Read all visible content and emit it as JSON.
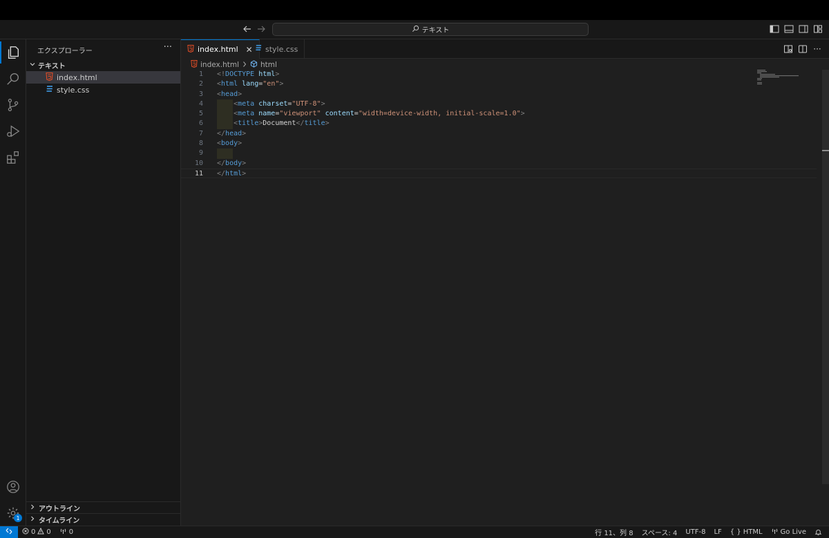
{
  "titlebar": {
    "search_text": "テキスト",
    "back_icon": "arrow-left-icon",
    "forward_icon": "arrow-right-icon"
  },
  "activitybar": {
    "items": [
      "explorer-icon",
      "search-icon",
      "source-control-icon",
      "run-debug-icon",
      "extensions-icon"
    ],
    "bottom": [
      "account-icon",
      "manage-gear-icon"
    ],
    "gear_badge": "1"
  },
  "sidebar": {
    "title": "エクスプローラー",
    "more": "···",
    "folder": "テキスト",
    "files": [
      {
        "name": "index.html",
        "icon": "html-file-icon",
        "selected": true
      },
      {
        "name": "style.css",
        "icon": "css-file-icon",
        "selected": false
      }
    ],
    "outline": "アウトライン",
    "timeline": "タイムライン"
  },
  "tabs": [
    {
      "label": "index.html",
      "active": true
    },
    {
      "label": "style.css",
      "active": false
    }
  ],
  "breadcrumb": {
    "file": "index.html",
    "symbol": "html"
  },
  "editor": {
    "current_line": 11,
    "lines": [
      {
        "n": "1",
        "tokens": [
          [
            "p",
            "<!"
          ],
          [
            "t",
            "DOCTYPE"
          ],
          [
            "x",
            " "
          ],
          [
            "a",
            "html"
          ],
          [
            "p",
            ">"
          ]
        ]
      },
      {
        "n": "2",
        "tokens": [
          [
            "p",
            "<"
          ],
          [
            "t",
            "html"
          ],
          [
            "x",
            " "
          ],
          [
            "a",
            "lang"
          ],
          [
            "x",
            "="
          ],
          [
            "s",
            "\"en\""
          ],
          [
            "p",
            ">"
          ]
        ]
      },
      {
        "n": "3",
        "tokens": [
          [
            "p",
            "<"
          ],
          [
            "t",
            "head"
          ],
          [
            "p",
            ">"
          ]
        ]
      },
      {
        "n": "4",
        "indent": true,
        "tokens": [
          [
            "x",
            "    "
          ],
          [
            "p",
            "<"
          ],
          [
            "t",
            "meta"
          ],
          [
            "x",
            " "
          ],
          [
            "a",
            "charset"
          ],
          [
            "x",
            "="
          ],
          [
            "s",
            "\"UTF-8\""
          ],
          [
            "p",
            ">"
          ]
        ]
      },
      {
        "n": "5",
        "indent": true,
        "tokens": [
          [
            "x",
            "    "
          ],
          [
            "p",
            "<"
          ],
          [
            "t",
            "meta"
          ],
          [
            "x",
            " "
          ],
          [
            "a",
            "name"
          ],
          [
            "x",
            "="
          ],
          [
            "s",
            "\"viewport\""
          ],
          [
            "x",
            " "
          ],
          [
            "a",
            "content"
          ],
          [
            "x",
            "="
          ],
          [
            "s",
            "\"width=device-width, initial-scale=1.0\""
          ],
          [
            "p",
            ">"
          ]
        ]
      },
      {
        "n": "6",
        "indent": true,
        "tokens": [
          [
            "x",
            "    "
          ],
          [
            "p",
            "<"
          ],
          [
            "t",
            "title"
          ],
          [
            "p",
            ">"
          ],
          [
            "x",
            "Document"
          ],
          [
            "p",
            "</"
          ],
          [
            "t",
            "title"
          ],
          [
            "p",
            ">"
          ]
        ]
      },
      {
        "n": "7",
        "tokens": [
          [
            "p",
            "</"
          ],
          [
            "t",
            "head"
          ],
          [
            "p",
            ">"
          ]
        ]
      },
      {
        "n": "8",
        "tokens": [
          [
            "p",
            "<"
          ],
          [
            "t",
            "body"
          ],
          [
            "p",
            ">"
          ]
        ]
      },
      {
        "n": "9",
        "indent": true,
        "tokens": []
      },
      {
        "n": "10",
        "tokens": [
          [
            "p",
            "</"
          ],
          [
            "t",
            "body"
          ],
          [
            "p",
            ">"
          ]
        ]
      },
      {
        "n": "11",
        "tokens": [
          [
            "p",
            "</"
          ],
          [
            "t",
            "html"
          ],
          [
            "p",
            ">"
          ]
        ]
      }
    ]
  },
  "statusbar": {
    "errors": "0",
    "warnings": "0",
    "ports": "0",
    "position": "行 11、列 8",
    "spaces": "スペース: 4",
    "encoding": "UTF-8",
    "eol": "LF",
    "language": "HTML",
    "golive": "Go Live"
  },
  "colors": {
    "accent": "#0078d4",
    "html_icon": "#e44d26",
    "css_icon": "#42a5f5"
  }
}
